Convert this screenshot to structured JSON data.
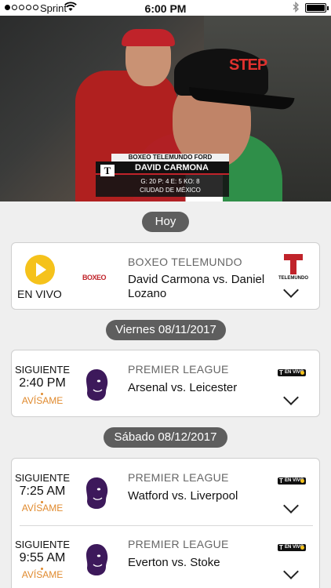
{
  "status_bar": {
    "carrier": "Sprint",
    "time": "6:00 PM"
  },
  "video": {
    "lower_third": {
      "program": "BOXEO TELEMUNDO FORD",
      "name": "DAVID CARMONA",
      "stats": "G: 20  P: 4  E: 5  KO: 8",
      "location": "CIUDAD DE MÉXICO"
    },
    "cap_text": "STEP"
  },
  "sections": [
    {
      "date": "Hoy",
      "events": [
        {
          "status": "EN VIVO",
          "channel_logo": "BOXEO",
          "league": "BOXEO TELEMUNDO",
          "match": "David Carmona vs. Daniel Lozano",
          "network": "TELEMUNDO"
        }
      ]
    },
    {
      "date": "Viernes 08/11/2017",
      "events": [
        {
          "status": "SIGUIENTE",
          "time": "2:40 PM",
          "remind": "AVÍSAME",
          "league": "PREMIER LEAGUE",
          "match": "Arsenal vs. Leicester",
          "network_badge": "EN VIVO"
        }
      ]
    },
    {
      "date": "Sábado 08/12/2017",
      "events": [
        {
          "status": "SIGUIENTE",
          "time": "7:25 AM",
          "remind": "AVÍSAME",
          "league": "PREMIER LEAGUE",
          "match": "Watford vs. Liverpool",
          "network_badge": "EN VIVO"
        },
        {
          "status": "SIGUIENTE",
          "time": "9:55 AM",
          "remind": "AVÍSAME",
          "league": "PREMIER LEAGUE",
          "match": "Everton vs. Stoke",
          "network_badge": "EN VIVO"
        }
      ]
    }
  ],
  "colors": {
    "accent_yellow": "#f5c21b",
    "remind_orange": "#e08a2e",
    "telemundo_red": "#c0232a",
    "premier_purple": "#3d195b",
    "pill_gray": "#5e5e5e"
  },
  "icons": {
    "play": "play-circle-icon",
    "expand": "chevron-down-icon",
    "league": "premier-league-lion-icon",
    "network": "telemundo-logo"
  }
}
